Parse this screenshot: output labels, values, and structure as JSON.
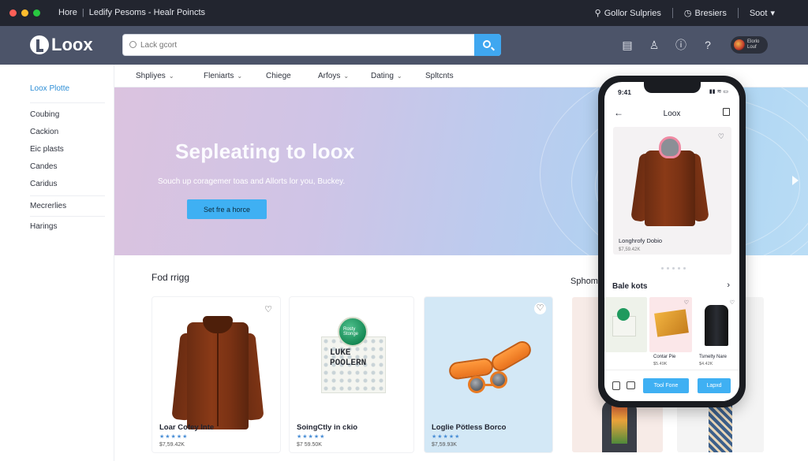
{
  "os_bar": {
    "crumb_home": "Hore",
    "crumb_page": "Ledify Pesoms - Healr Poincts",
    "right_item1": "Gollor Sulpries",
    "right_item2": "Bresiers",
    "right_item3": "Soot"
  },
  "header": {
    "logo_text": "Loox",
    "search_placeholder": "Lack gcort",
    "user_line1": "Elorlo",
    "user_line2": "Louf"
  },
  "sidebar": {
    "title": "Loox Plotte",
    "items": [
      "Coubing",
      "Cackion",
      "Eic plasts",
      "Candes",
      "Caridus",
      "Mecrerlies",
      "Harings"
    ]
  },
  "subnav": {
    "items": [
      "Shpliyes",
      "Fleniarts",
      "Chiege",
      "Arfoys",
      "Dating",
      "Spltcnts"
    ]
  },
  "hero": {
    "title": "Sepleating to loox",
    "subtitle": "Souch up coragemer toas and Allorts lor you, Buckey.",
    "button": "Set fre a horce"
  },
  "section": {
    "title": "Fod rrigg",
    "side_title": "Sphom"
  },
  "products": [
    {
      "name": "Loar Cofey Inte",
      "stars": "★★★★★",
      "price": "$7,59.42K"
    },
    {
      "name": "SoingCtly in ckio",
      "stars": "★★★★★",
      "price": "$7 59.50K"
    },
    {
      "name": "Loglie Pötless Borco",
      "stars": "★★★★★",
      "price": "$7,59.93K"
    }
  ],
  "product_box_label": "LUKE\nPOOLERN",
  "product_box_badge": "Rosty\nStonge",
  "phone": {
    "time": "9:41",
    "status": "▮▮ ≋ ▭",
    "nav_title": "Loox",
    "card_name": "Longhrofy Dobio",
    "card_price": "$7,59.42K",
    "section_title": "Bale kots",
    "tiles": [
      {
        "name": "",
        "price": ""
      },
      {
        "name": "Contar Pie",
        "price": "$5.49K"
      },
      {
        "name": "Tsmelty Nare",
        "price": "$4.42K"
      }
    ],
    "btn_primary": "Tool Fone",
    "btn_secondary": "Lapxd"
  }
}
